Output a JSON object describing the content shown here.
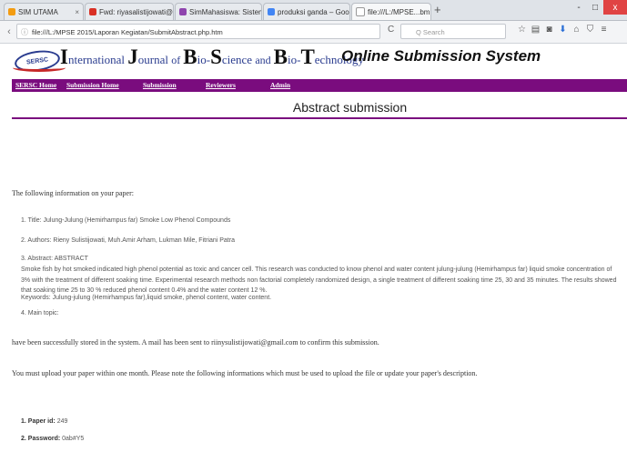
{
  "browser": {
    "tabs": [
      {
        "label": "SIM UTAMA",
        "icon": "orange"
      },
      {
        "label": "Fwd: riyasalistijowati@g...",
        "icon": "gmail"
      },
      {
        "label": "SimMahasiswa: Sistem Informas...",
        "icon": "purple"
      },
      {
        "label": "produksi ganda – Googl...",
        "icon": "google"
      },
      {
        "label": "file:///L:/MPSE...bmit.php.htm",
        "icon": "page"
      }
    ],
    "new_tab": "+",
    "window_buttons": [
      "-",
      "□",
      "x"
    ],
    "url": "file:///L:/MPSE 2015/Laporan Kegiatan/SubmitAbstract.php.htm",
    "search_placeholder": "Q Search",
    "reload": "C"
  },
  "header": {
    "logo_text": "SERSC",
    "journal_parts": [
      {
        "big": "I",
        "rest": "nternational "
      },
      {
        "big": "J",
        "rest": "ournal "
      },
      {
        "small": "of "
      },
      {
        "big": "B",
        "rest": "io-"
      },
      {
        "big": "S",
        "rest": "cience "
      },
      {
        "small": "and "
      },
      {
        "big": "B",
        "rest": "io-"
      },
      {
        "big": "T",
        "rest": "echnology"
      }
    ],
    "system_title": "Online Submission System"
  },
  "menu": {
    "items": [
      "SERSC Home",
      "Submission Home",
      "Submission",
      "Reviewers",
      "Admin"
    ]
  },
  "page_title": "Abstract submission",
  "content": {
    "intro": "The following information on your paper:",
    "item1": "1. Title: Julung-Julung (Hemirhampus far) Smoke Low Phenol Compounds",
    "item2": "2. Authors: Rieny Sulistijowati, Muh.Amir Arham, Lukman Mile, Fitriani Patra",
    "item3_label": "3. Abstract: ABSTRACT",
    "abstract": "Smoke fish by hot smoked indicated high phenol potential as toxic and cancer cell. This research was conducted to know phenol and water content julung-julung (Hemirhampus far) liquid smoke concentration of 3% with the treatment of different soaking time. Experimental research methods non factorial completely randomized design, a single treatment of different soaking time 25, 30 and 35 minutes. The results showed that soaking time 25 to 30 % reduced phenol content 0.4% and the water content 12 %.",
    "keywords": "Keywords: Julung-julung (Hemirhampus far),liquid smoke, phenol content, water content.",
    "item4": "4. Main topic:",
    "stored": "have been successfully stored in the system. A mail has been sent to riinysulistijowati@gmail.com to confirm this submission.",
    "upload": "You must upload your paper within one month. Please note the following informations which must be used to upload the file or update your paper's description.",
    "paper_id_label": "1. Paper id:",
    "paper_id_value": "249",
    "password_label": "2. Password:",
    "password_value": "0ab#Y5"
  },
  "colors": {
    "menu_bg": "#7a0c7e",
    "journal_blue": "#2a3c8f",
    "logo_red": "#c62828"
  }
}
